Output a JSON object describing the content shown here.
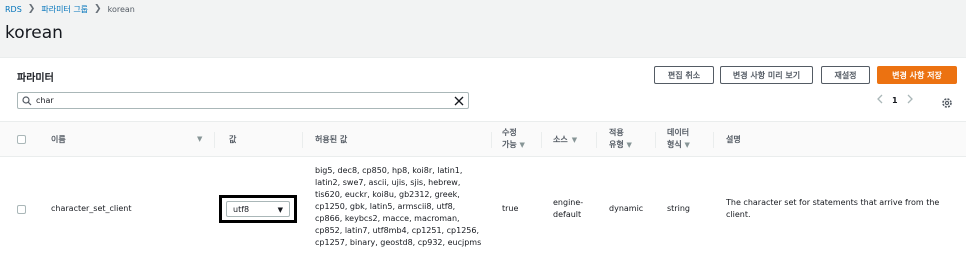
{
  "breadcrumb": {
    "root": "RDS",
    "parent": "파라미터 그룹",
    "current": "korean"
  },
  "page_title": "korean",
  "panel": {
    "title": "파라미터",
    "buttons": {
      "cancel_edit": "편집 취소",
      "preview_changes": "변경 사항 미리 보기",
      "reset": "재설정",
      "save_changes": "변경 사항 저장"
    },
    "search": {
      "value": "char"
    },
    "pagination": {
      "current_page": "1"
    }
  },
  "table": {
    "headers": {
      "name": "이름",
      "value": "값",
      "allowed_values": "허용된 값",
      "modifiable_1": "수정",
      "modifiable_2": "가능",
      "source": "소스",
      "apply_type_1": "적용",
      "apply_type_2": "유형",
      "data_type_1": "데이터",
      "data_type_2": "형식",
      "description": "설명"
    },
    "rows": [
      {
        "name": "character_set_client",
        "value": "utf8",
        "allowed_values": [
          "big5, dec8, cp850, hp8, koi8r, latin1,",
          "latin2, swe7, ascii, ujis, sjis, hebrew,",
          "tis620, euckr, koi8u, gb2312, greek,",
          "cp1250, gbk, latin5, armscii8, utf8,",
          "cp866, keybcs2, macce, macroman,",
          "cp852, latin7, utf8mb4, cp1251, cp1256,",
          "cp1257, binary, geostd8, cp932, eucjpms"
        ],
        "modifiable": "true",
        "source_1": "engine-",
        "source_2": "default",
        "apply_type": "dynamic",
        "data_type": "string",
        "description_1": "The character set for statements that arrive from the",
        "description_2": "client."
      }
    ]
  },
  "colors": {
    "link": "#0073bb",
    "primary_button": "#ec7211",
    "highlight_border": "#000000"
  },
  "icons": [
    "chevron-right-icon",
    "search-icon",
    "clear-icon",
    "chevron-left-icon",
    "gear-icon",
    "caret-down-icon"
  ]
}
